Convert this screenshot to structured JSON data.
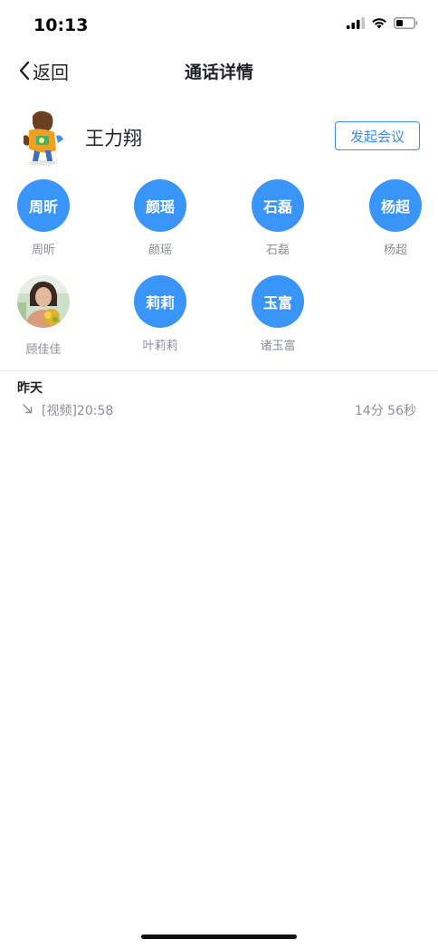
{
  "status_bar": {
    "time": "10:13"
  },
  "nav": {
    "back_label": "返回",
    "title": "通话详情"
  },
  "host": {
    "name": "王力翔",
    "start_meeting_label": "发起会议"
  },
  "members": [
    {
      "avatar_text": "周昕",
      "name": "周昕",
      "avatar_type": "text"
    },
    {
      "avatar_text": "颜瑶",
      "name": "颜瑶",
      "avatar_type": "text"
    },
    {
      "avatar_text": "石磊",
      "name": "石磊",
      "avatar_type": "text"
    },
    {
      "avatar_text": "杨超",
      "name": "杨超",
      "avatar_type": "text"
    },
    {
      "avatar_text": "",
      "name": "顾佳佳",
      "avatar_type": "photo"
    },
    {
      "avatar_text": "莉莉",
      "name": "叶莉莉",
      "avatar_type": "text"
    },
    {
      "avatar_text": "玉富",
      "name": "诸玉富",
      "avatar_type": "text"
    }
  ],
  "records": {
    "date_label": "昨天",
    "items": [
      {
        "type_time": "[视频]20:58",
        "duration": "14分 56秒",
        "direction_icon": "incoming-arrow-icon"
      }
    ]
  },
  "colors": {
    "accent": "#3a95fb",
    "secondary_text": "#8a8f99"
  }
}
